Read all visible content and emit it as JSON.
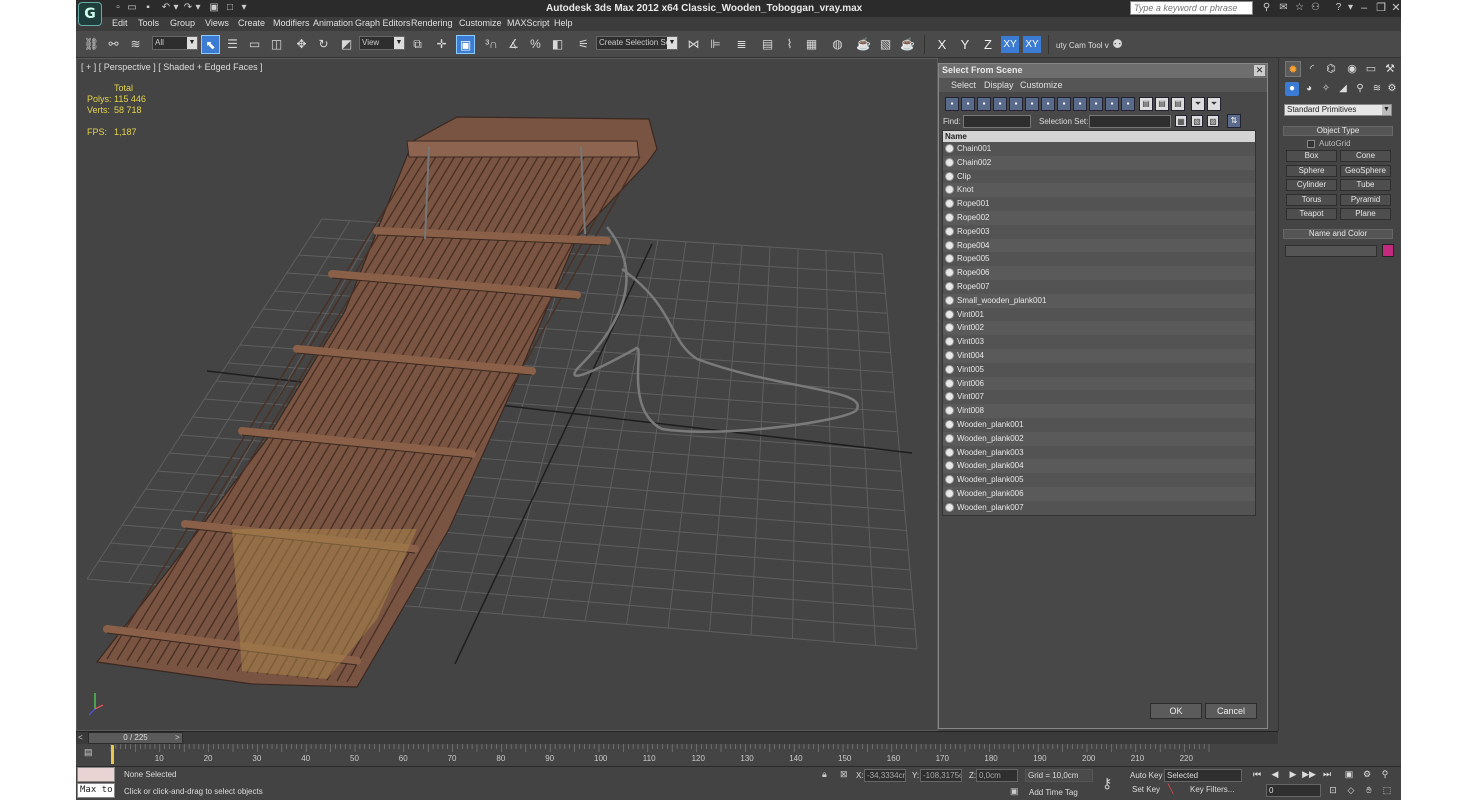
{
  "window": {
    "title": "Autodesk 3ds Max  2012 x64     Classic_Wooden_Toboggan_vray.max",
    "search_placeholder": "Type a keyword or phrase",
    "logo": "G"
  },
  "menu": [
    "Edit",
    "Tools",
    "Group",
    "Views",
    "Create",
    "Modifiers",
    "Animation",
    "Graph Editors",
    "Rendering",
    "Customize",
    "MAXScript",
    "Help"
  ],
  "toolbar": {
    "selection_filter": "All",
    "ref_coord": "View",
    "named_selection": "Create Selection Se",
    "axis_x": "X",
    "axis_y": "Y",
    "axis_z": "Z",
    "axis_xy": "XY",
    "axis_xy2": "XY",
    "cam_tool": "uty Cam Tool v"
  },
  "viewport": {
    "label": "[ + ] [ Perspective ] [ Shaded + Edged Faces ]",
    "stats_header": "Total",
    "polys_label": "Polys:",
    "polys_value": "115 446",
    "verts_label": "Verts:",
    "verts_value": "58 718",
    "fps_label": "FPS:",
    "fps_value": "1,187"
  },
  "dialog": {
    "title": "Select From Scene",
    "menu": [
      "Select",
      "Display",
      "Customize"
    ],
    "find_label": "Find:",
    "selection_set_label": "Selection Set:",
    "column_name": "Name",
    "items": [
      "Chain001",
      "Chain002",
      "Clip",
      "Knot",
      "Rope001",
      "Rope002",
      "Rope003",
      "Rope004",
      "Rope005",
      "Rope006",
      "Rope007",
      "Small_wooden_plank001",
      "Vint001",
      "Vint002",
      "Vint003",
      "Vint004",
      "Vint005",
      "Vint006",
      "Vint007",
      "Vint008",
      "Wooden_plank001",
      "Wooden_plank002",
      "Wooden_plank003",
      "Wooden_plank004",
      "Wooden_plank005",
      "Wooden_plank006",
      "Wooden_plank007"
    ],
    "ok": "OK",
    "cancel": "Cancel"
  },
  "command_panel": {
    "category": "Standard Primitives",
    "object_type_title": "Object Type",
    "autogrid": "AutoGrid",
    "buttons": [
      "Box",
      "Cone",
      "Sphere",
      "GeoSphere",
      "Cylinder",
      "Tube",
      "Torus",
      "Pyramid",
      "Teapot",
      "Plane"
    ],
    "name_color_title": "Name and Color",
    "color": "#c22a7e"
  },
  "timeline": {
    "frame_counter": "0 / 225",
    "ticks": [
      "10",
      "20",
      "30",
      "40",
      "50",
      "60",
      "70",
      "80",
      "90",
      "100",
      "110",
      "120",
      "130",
      "140",
      "150",
      "160",
      "170",
      "180",
      "190",
      "200",
      "210",
      "220"
    ]
  },
  "status": {
    "maxscript_listener": "Max to",
    "selection": "None Selected",
    "prompt": "Click or click-and-drag to select objects",
    "x_label": "X:",
    "x_value": "-34,3334cr",
    "y_label": "Y:",
    "y_value": "-108,3175c",
    "z_label": "Z:",
    "z_value": "0,0cm",
    "grid": "Grid = 10,0cm",
    "auto_key": "Auto Key",
    "selected": "Selected",
    "set_key": "Set Key",
    "key_filters": "Key Filters...",
    "add_time_tag": "Add Time Tag",
    "frame": "0"
  }
}
